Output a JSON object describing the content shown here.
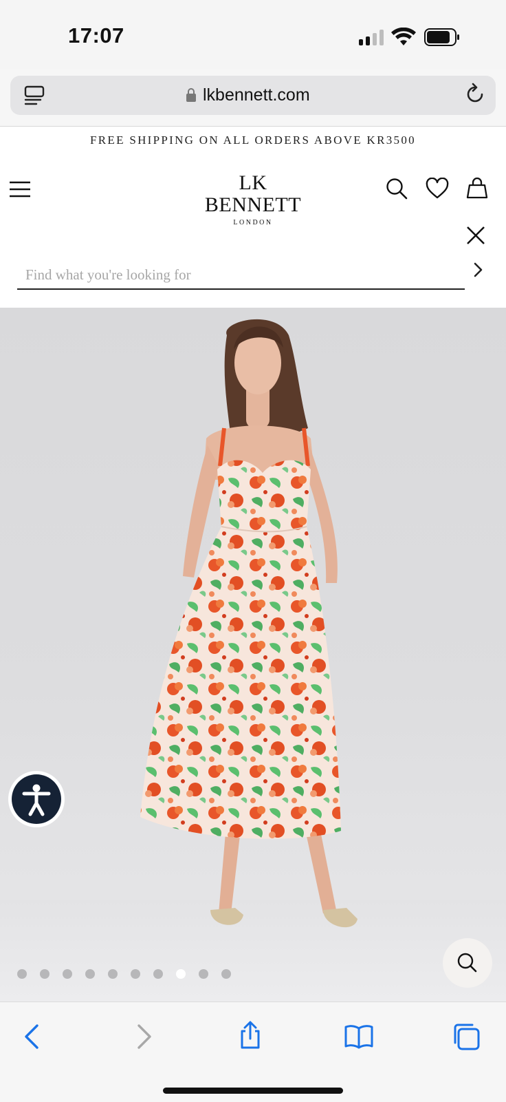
{
  "status_bar": {
    "time": "17:07"
  },
  "browser": {
    "url": "lkbennett.com"
  },
  "site": {
    "promo_banner": "FREE SHIPPING ON ALL ORDERS ABOVE KR3500",
    "logo": {
      "main": "LK BENNETT",
      "sub": "LONDON"
    },
    "search": {
      "placeholder": "Find what you're looking for",
      "value": ""
    }
  },
  "gallery": {
    "image_count": 10,
    "active_index": 7
  },
  "icons": {
    "header": [
      "menu-icon",
      "search-icon",
      "heart-icon",
      "bag-icon"
    ],
    "toolbar": [
      "back-icon",
      "forward-icon",
      "share-icon",
      "bookmarks-icon",
      "tabs-icon"
    ]
  },
  "colors": {
    "accent": "#1a73e8",
    "accessibility_badge": "#152235",
    "dress_orange": "#e8562a",
    "dress_green": "#5bbf6e",
    "dress_base": "#f7e6dc"
  }
}
